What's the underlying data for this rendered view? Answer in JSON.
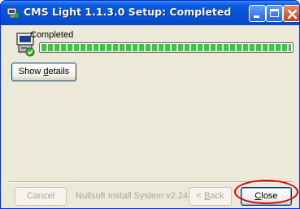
{
  "window": {
    "title": "CMS Light 1.1.3.0 Setup: Completed",
    "app_icon": "installer-icon",
    "controls": [
      "minimize-icon",
      "maximize-icon",
      "close-icon"
    ]
  },
  "header": {
    "icon": "installer-computer-icon",
    "status": "Completed"
  },
  "progress": {
    "value": 1.0,
    "color": "#35C93C"
  },
  "buttons": {
    "show_details": {
      "pre": "Show ",
      "key": "d",
      "post": "etails"
    },
    "cancel": "Cancel",
    "back": {
      "pre": "< ",
      "key": "B",
      "post": "ack"
    },
    "close": {
      "pre": "",
      "key": "C",
      "post": "lose"
    }
  },
  "footer": {
    "branding": "Nullsoft Install System v2.24"
  },
  "highlight": {
    "color": "#E00000",
    "target": "close-button"
  }
}
